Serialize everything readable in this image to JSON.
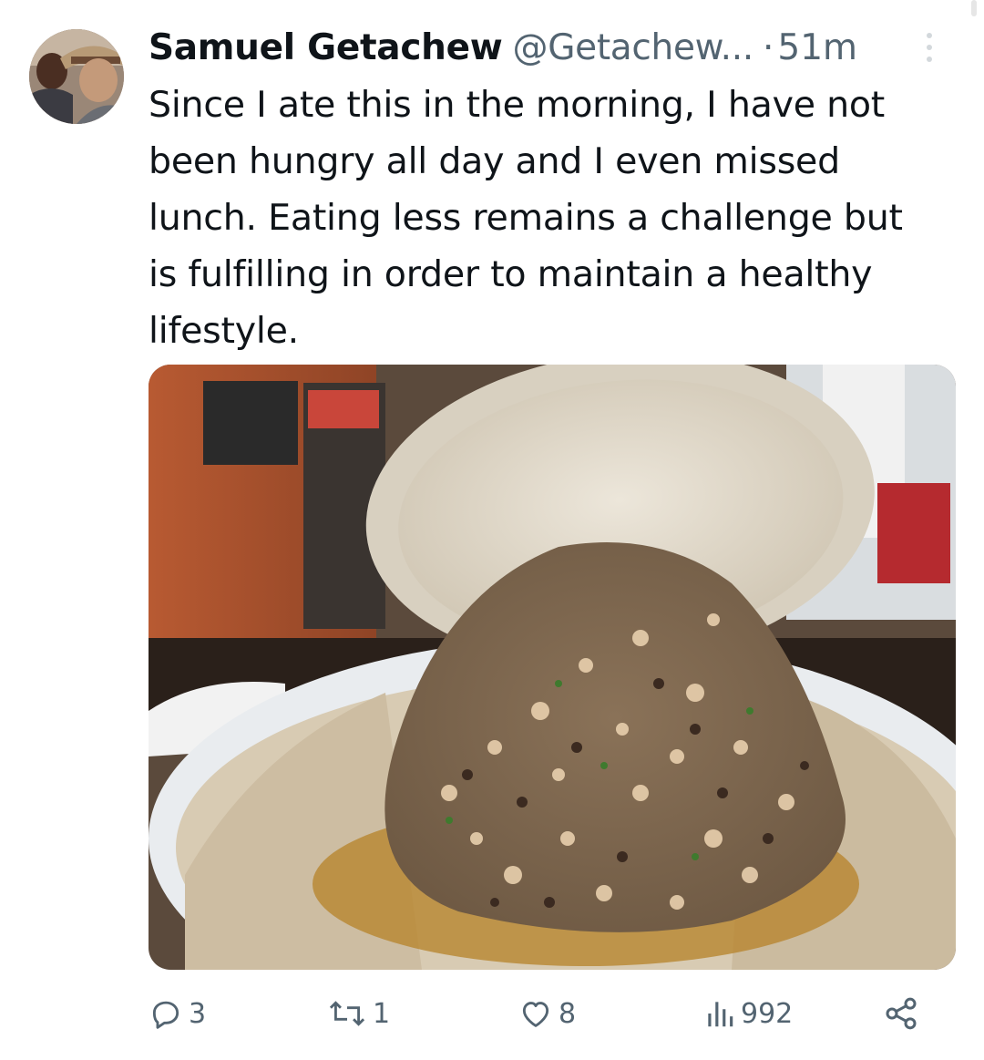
{
  "tweet": {
    "author_name": "Samuel Getachew",
    "handle": "@Getachew...",
    "separator": "·",
    "time": "51m",
    "text": "Since I ate this in the morning, I have not\nbeen hungry all day and I even missed\nlunch. Eating less remains a challenge but\nis fulfilling in order to maintain a healthy\nlifestyle."
  },
  "actions": {
    "reply_count": "3",
    "retweet_count": "1",
    "like_count": "8",
    "views_count": "992"
  },
  "icons": {
    "more": "more-vertical-icon",
    "reply": "reply-icon",
    "retweet": "retweet-icon",
    "like": "heart-icon",
    "views": "views-bar-chart-icon",
    "share": "share-icon"
  },
  "colors": {
    "text": "#0f1419",
    "secondary": "#536471",
    "background": "#ffffff"
  }
}
